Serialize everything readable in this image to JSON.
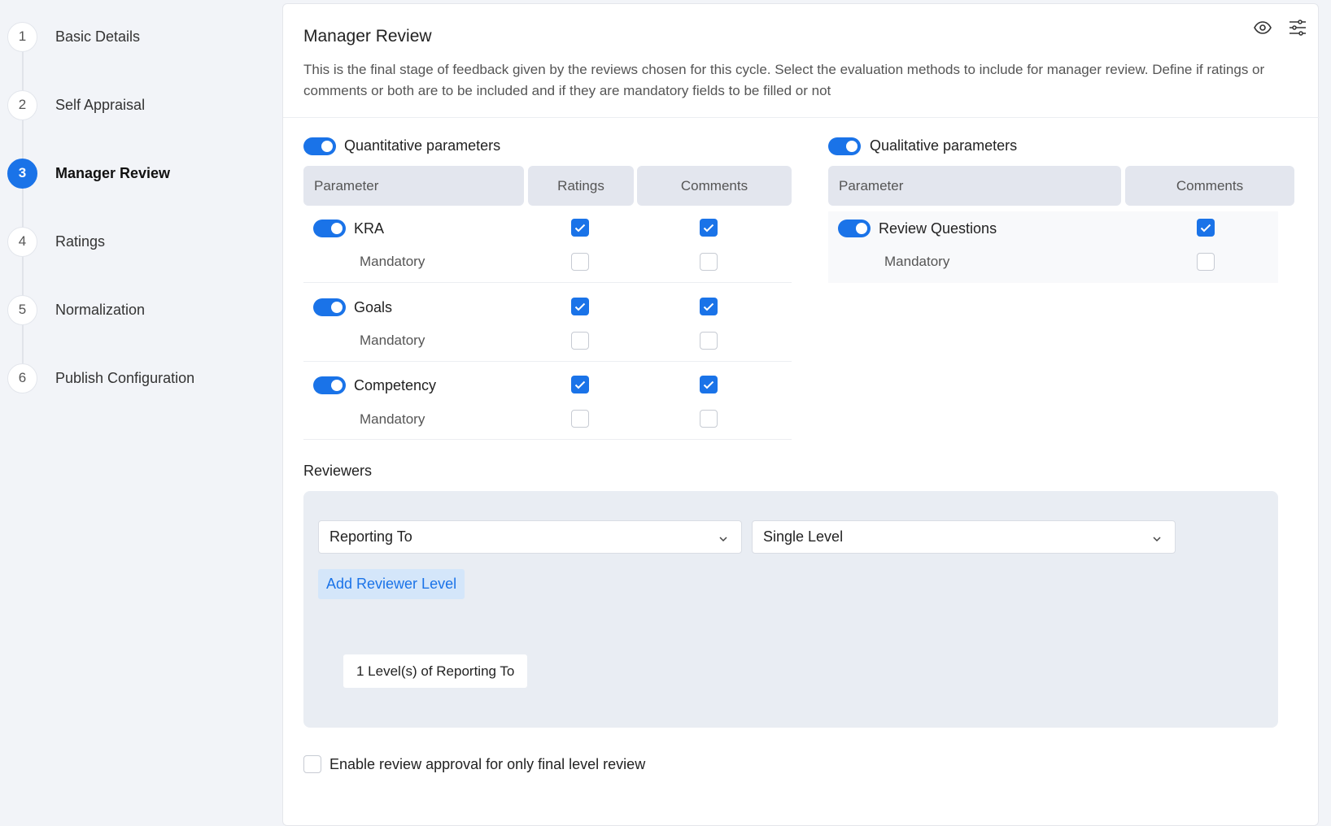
{
  "steps": [
    {
      "num": "1",
      "label": "Basic Details",
      "active": false
    },
    {
      "num": "2",
      "label": "Self Appraisal",
      "active": false
    },
    {
      "num": "3",
      "label": "Manager Review",
      "active": true
    },
    {
      "num": "4",
      "label": "Ratings",
      "active": false
    },
    {
      "num": "5",
      "label": "Normalization",
      "active": false
    },
    {
      "num": "6",
      "label": "Publish Configuration",
      "active": false
    }
  ],
  "panel": {
    "title": "Manager Review",
    "description": "This is the final stage of feedback given by the reviews chosen for this cycle. Select the evaluation methods to include for manager review. Define if ratings or comments or both are to be included and if they are mandatory fields to be filled or not",
    "icons": [
      "eye-icon",
      "sliders-icon"
    ]
  },
  "quantitative": {
    "enabled": true,
    "label": "Quantitative parameters",
    "headers": {
      "parameter": "Parameter",
      "ratings": "Ratings",
      "comments": "Comments"
    },
    "rows": [
      {
        "name": "KRA",
        "enabled": true,
        "ratings": true,
        "comments": true,
        "mandatory_label": "Mandatory",
        "mandatory_ratings": false,
        "mandatory_comments": false
      },
      {
        "name": "Goals",
        "enabled": true,
        "ratings": true,
        "comments": true,
        "mandatory_label": "Mandatory",
        "mandatory_ratings": false,
        "mandatory_comments": false
      },
      {
        "name": "Competency",
        "enabled": true,
        "ratings": true,
        "comments": true,
        "mandatory_label": "Mandatory",
        "mandatory_ratings": false,
        "mandatory_comments": false
      }
    ]
  },
  "qualitative": {
    "enabled": true,
    "label": "Qualitative parameters",
    "headers": {
      "parameter": "Parameter",
      "comments": "Comments"
    },
    "rows": [
      {
        "name": "Review Questions",
        "enabled": true,
        "comments": true,
        "mandatory_label": "Mandatory",
        "mandatory_comments": false
      }
    ]
  },
  "reviewers": {
    "title": "Reviewers",
    "reviewer_type": "Reporting To",
    "level_type": "Single Level",
    "add_level_label": "Add Reviewer Level",
    "levels": [
      "1 Level(s) of Reporting To"
    ]
  },
  "approval": {
    "label": "Enable review approval for only final level review",
    "checked": false
  },
  "colors": {
    "accent": "#1a73e8",
    "header_bg": "#e3e6ee",
    "page_bg": "#f2f4f8"
  }
}
